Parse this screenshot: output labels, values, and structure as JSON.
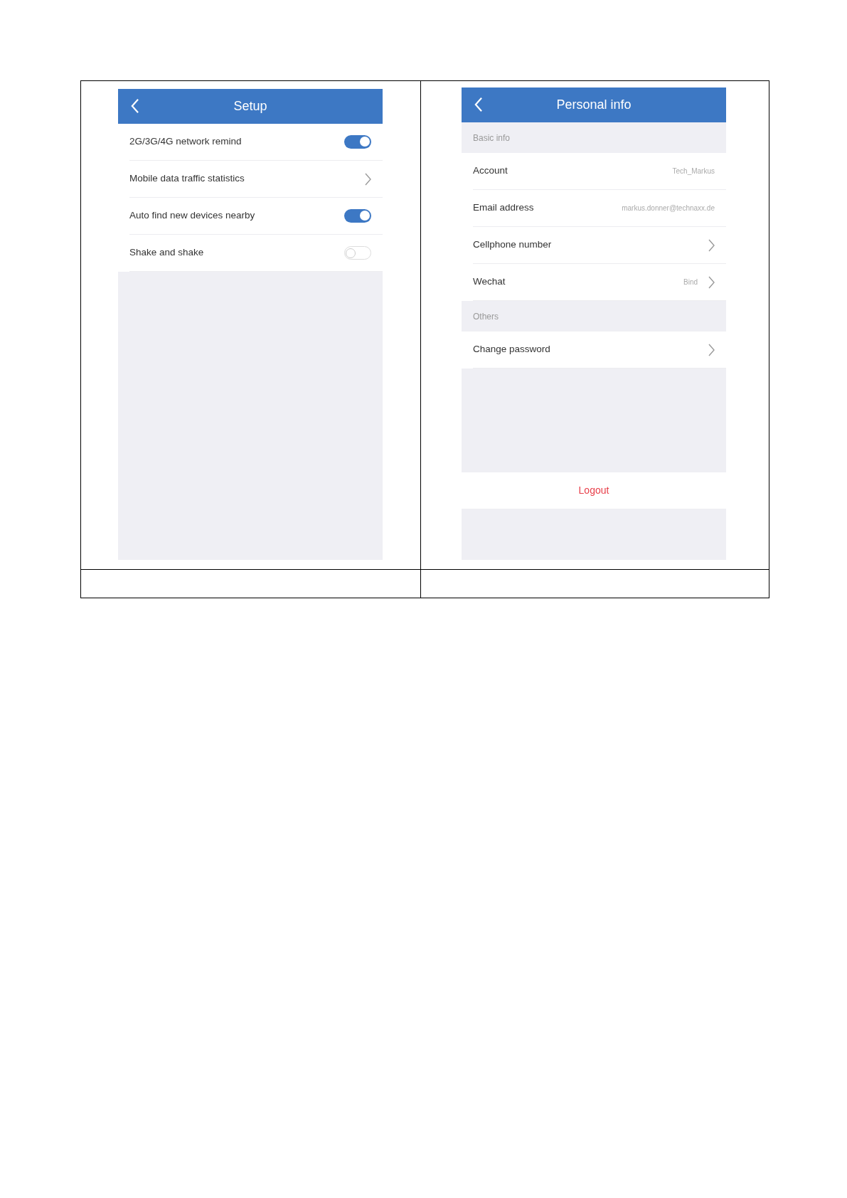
{
  "setup_screen": {
    "title": "Setup",
    "items": [
      {
        "kind": "toggle",
        "label": "2G/3G/4G network remind",
        "on": true
      },
      {
        "kind": "link",
        "label": "Mobile data traffic statistics"
      },
      {
        "kind": "toggle",
        "label": "Auto find new devices nearby",
        "on": true
      },
      {
        "kind": "toggle",
        "label": "Shake and shake",
        "on": false
      }
    ]
  },
  "personal_info_screen": {
    "title": "Personal info",
    "items": [
      {
        "kind": "section",
        "label": "Basic info"
      },
      {
        "kind": "row",
        "label": "Account",
        "value": "Tech_Markus",
        "chevron": false
      },
      {
        "kind": "row",
        "label": "Email address",
        "value": "markus.donner@technaxx.de",
        "chevron": false
      },
      {
        "kind": "row",
        "label": "Cellphone number",
        "chevron": true
      },
      {
        "kind": "row",
        "label": "Wechat",
        "value": "Bind",
        "chevron": true
      },
      {
        "kind": "section",
        "label": "Others"
      },
      {
        "kind": "row",
        "label": "Change password",
        "chevron": true
      }
    ],
    "logout": "Logout"
  }
}
